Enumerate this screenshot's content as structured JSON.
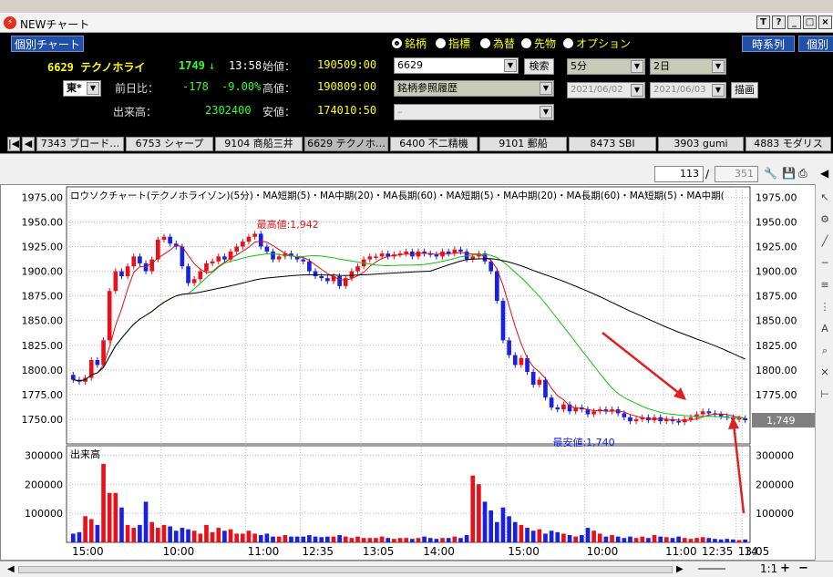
{
  "window": {
    "title": "NEWチャート"
  },
  "titlebar_buttons": [
    "T",
    "?",
    "_",
    "□",
    "×"
  ],
  "header": {
    "mode_button": "個別チャート",
    "code_name": "6629 テクノホライ",
    "price": "1749",
    "arrow": "↓",
    "time": "13:58",
    "exchange": "東*",
    "open_label": "始値：",
    "open_value": "1905",
    "open_time": "09:00",
    "high_label": "高値：",
    "high_value": "1908",
    "high_time": "09:00",
    "low_label": "安値：",
    "low_value": "1740",
    "low_time": "10:50",
    "change_label": "前日比：",
    "change_value": "-178",
    "change_pct": "-9.00%",
    "volume_label": "出来高：",
    "volume_value": "2302400",
    "radios": [
      "銘柄",
      "指標",
      "為替",
      "先物",
      "オプション"
    ],
    "code_input": "6629",
    "search_button": "検索",
    "history_combo": "銘柄参照履歴",
    "blank_combo": "–",
    "interval": "5分",
    "period": "2日",
    "date_from": "2021/06/02",
    "date_to": "2021/06/03",
    "draw_button": "描画",
    "timeseries_button": "時系列",
    "individual_button": "個別"
  },
  "tabs": [
    "7343 ブロード…",
    "6753 シャープ",
    "9104 商船三井",
    "6629 テクノホ…",
    "6400 不二精機",
    "9101 郵船",
    "8473 SBI",
    "3903 gumi",
    "4883 モダリス"
  ],
  "paging": {
    "current": "113",
    "separator": "/",
    "total": "351"
  },
  "chart_data": {
    "type": "candlestick",
    "legend": "ロウソクチャート(テクノホライゾン)(5分)・MA短期(5)・MA中期(20)・MA長期(60)・MA短期(5)・MA中期(20)・MA長期(60)・MA短期(5)・MA中期(",
    "y_ticks": [
      "1975.00",
      "1950.00",
      "1925.00",
      "1900.00",
      "1875.00",
      "1850.00",
      "1825.00",
      "1800.00",
      "1775.00",
      "1750.00"
    ],
    "ylim": [
      1725,
      1980
    ],
    "x_ticks": [
      "15:00",
      "10:00",
      "11:00",
      "12:35",
      "13:05",
      "14:00",
      "15:00",
      "10:00",
      "11:00",
      "12:35",
      "13:05",
      "14"
    ],
    "high_annotation": "最高値:1,942",
    "low_annotation": "最安値:1,740",
    "last_price_label": "1,749",
    "volume_label": "出来高",
    "volume_ticks": [
      "300000",
      "200000",
      "100000"
    ],
    "volume_ylim": [
      0,
      320000
    ],
    "colors": {
      "up": "#e8101a",
      "down": "#1a20e0",
      "ma_short": "#e01010",
      "ma_mid": "#10c010",
      "ma_long": "#000000",
      "arrow": "#e02020"
    },
    "close": [
      1790,
      1788,
      1792,
      1810,
      1805,
      1830,
      1880,
      1900,
      1895,
      1905,
      1915,
      1908,
      1900,
      1912,
      1932,
      1935,
      1928,
      1925,
      1905,
      1888,
      1892,
      1900,
      1908,
      1910,
      1915,
      1912,
      1920,
      1925,
      1930,
      1935,
      1938,
      1925,
      1920,
      1912,
      1915,
      1918,
      1915,
      1912,
      1910,
      1900,
      1895,
      1893,
      1890,
      1895,
      1885,
      1893,
      1900,
      1905,
      1912,
      1915,
      1915,
      1918,
      1915,
      1917,
      1918,
      1920,
      1915,
      1920,
      1918,
      1917,
      1915,
      1920,
      1918,
      1922,
      1920,
      1912,
      1915,
      1918,
      1910,
      1900,
      1870,
      1830,
      1815,
      1805,
      1812,
      1798,
      1785,
      1790,
      1772,
      1762,
      1760,
      1765,
      1758,
      1762,
      1760,
      1755,
      1758,
      1760,
      1758,
      1760,
      1756,
      1752,
      1748,
      1750,
      1752,
      1749,
      1752,
      1748,
      1750,
      1748,
      1747,
      1750,
      1752,
      1755,
      1758,
      1756,
      1755,
      1753,
      1752,
      1750,
      1751,
      1749
    ],
    "volume": [
      30000,
      35000,
      90000,
      80000,
      60000,
      270000,
      170000,
      170000,
      120000,
      60000,
      50000,
      60000,
      140000,
      70000,
      50000,
      60000,
      55000,
      40000,
      50000,
      45000,
      40000,
      30000,
      60000,
      35000,
      50000,
      40000,
      45000,
      30000,
      30000,
      40000,
      30000,
      25000,
      30000,
      20000,
      20000,
      25000,
      20000,
      20000,
      20000,
      25000,
      20000,
      18000,
      20000,
      20000,
      25000,
      20000,
      15000,
      20000,
      15000,
      15000,
      15000,
      20000,
      15000,
      12000,
      15000,
      15000,
      12000,
      15000,
      20000,
      15000,
      12000,
      15000,
      15000,
      20000,
      15000,
      25000,
      230000,
      200000,
      140000,
      110000,
      70000,
      120000,
      90000,
      70000,
      60000,
      50000,
      40000,
      45000,
      30000,
      40000,
      35000,
      30000,
      25000,
      20000,
      25000,
      50000,
      40000,
      30000,
      20000,
      25000,
      20000,
      15000,
      20000,
      15000,
      20000,
      15000,
      25000,
      20000,
      18000,
      15000,
      20000,
      15000,
      12000,
      15000,
      18000,
      15000,
      12000,
      10000,
      12000,
      10000,
      8000,
      10000
    ]
  }
}
